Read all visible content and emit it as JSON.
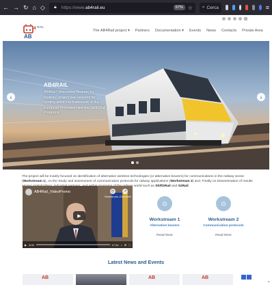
{
  "browser": {
    "url_protocol": "https://www.",
    "url_domain": "ab4rail.eu",
    "zoom": "67%",
    "search_placeholder": "Cerca"
  },
  "site": {
    "logo_text": "AB4RAIL",
    "nav": [
      "The AB4Rail project ▾",
      "Partners",
      "Documentation ▾",
      "Events",
      "News",
      "Contacts",
      "Private Area"
    ]
  },
  "hero": {
    "title": "AB4RAIL",
    "text": "AB4Rail (Alternative Bearers for Railway) project was selected for funding within the framework of the European Innovation and the Shift2Rail Programs."
  },
  "intro": {
    "part1": "The project will be mainly focused on identification of alternative wireless technologies (or alternative bearers) for communications in the railway sector (",
    "ws1": "Workstream 1",
    "part2": "), on the Study and assessment of communication protocols for railway applications (",
    "ws2": "Workstream 2",
    "part3": ") and, Finally on Dissemination of results among stakeholders, industrial partners, and within programs of the railway world such as ",
    "s2r": "Shift2Rail",
    "part4": " and ",
    "s2r2": "S2Rail",
    "part5": "."
  },
  "video": {
    "title": "AB4Rail_VideoPromo",
    "watch_later": "Guarda più...",
    "share": "Condividi",
    "time_current": "0:00",
    "time_total": "17:24"
  },
  "workstreams": [
    {
      "title": "Workstream 1",
      "subtitle": "Alternative bearers",
      "more": "Read More"
    },
    {
      "title": "Workstream 2",
      "subtitle": "Communication protocols",
      "more": "Read More"
    }
  ],
  "news": {
    "heading": "Latest News and Events",
    "card_logo": "AB"
  },
  "colors": {
    "accent": "#2a5a8f",
    "logo_red": "#c0392b",
    "chrome": "#2b2a33"
  }
}
